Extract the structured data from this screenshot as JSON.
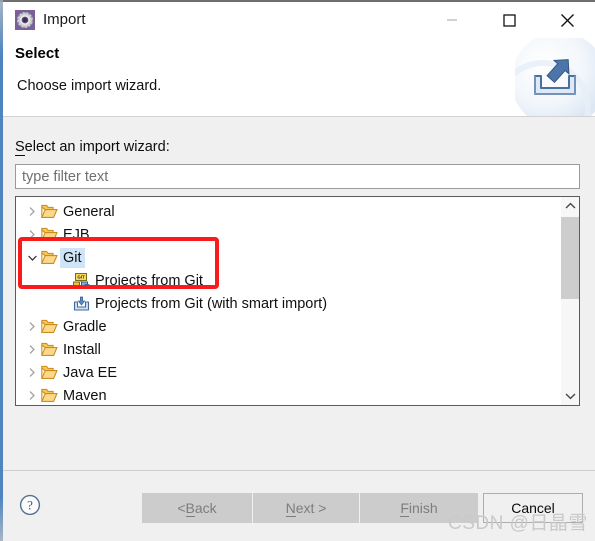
{
  "window": {
    "title": "Import",
    "app_icon": "eclipse-import-gear-icon",
    "controls": {
      "minimize": "minimize-icon",
      "maximize": "maximize-icon",
      "close": "close-icon"
    }
  },
  "header": {
    "title": "Select",
    "subtitle": "Choose import wizard.",
    "banner_icon": "import-tray-arrow-icon"
  },
  "body": {
    "wizard_label_prefix": "S",
    "wizard_label_rest": "elect an import wizard:",
    "filter": {
      "value": "",
      "placeholder": "type filter text"
    },
    "tree": [
      {
        "label": "General",
        "icon": "folder-icon",
        "indent": 0,
        "twisty": "collapsed",
        "selected": false
      },
      {
        "label": "EJB",
        "icon": "folder-icon",
        "indent": 0,
        "twisty": "collapsed",
        "selected": false
      },
      {
        "label": "Git",
        "icon": "folder-icon",
        "indent": 0,
        "twisty": "expanded",
        "selected": true
      },
      {
        "label": "Projects from Git",
        "icon": "git-projects-icon",
        "indent": 1,
        "twisty": "none",
        "selected": false
      },
      {
        "label": "Projects from Git (with smart import)",
        "icon": "git-smart-import-icon",
        "indent": 1,
        "twisty": "none",
        "selected": false
      },
      {
        "label": "Gradle",
        "icon": "folder-icon",
        "indent": 0,
        "twisty": "collapsed",
        "selected": false
      },
      {
        "label": "Install",
        "icon": "folder-icon",
        "indent": 0,
        "twisty": "collapsed",
        "selected": false
      },
      {
        "label": "Java EE",
        "icon": "folder-icon",
        "indent": 0,
        "twisty": "collapsed",
        "selected": false
      },
      {
        "label": "Maven",
        "icon": "folder-icon",
        "indent": 0,
        "twisty": "collapsed",
        "selected": false
      }
    ],
    "annotation": {
      "color": "#f91b1b",
      "targets": [
        "Git",
        "Projects from Git"
      ]
    },
    "scrollbar": {
      "up_icon": "chevron-up-icon",
      "down_icon": "chevron-down-icon",
      "thumb_position_percent": 2
    }
  },
  "footer": {
    "help_icon": "help-question-icon",
    "buttons": [
      {
        "label_prefix": "< ",
        "label_key": "B",
        "label_rest": "ack",
        "full": "< Back",
        "enabled": false
      },
      {
        "label_prefix": "",
        "label_key": "N",
        "label_rest": "ext >",
        "full": "Next >",
        "enabled": false
      },
      {
        "label_prefix": "",
        "label_key": "F",
        "label_rest": "inish",
        "full": "Finish",
        "enabled": false
      },
      {
        "label_prefix": "",
        "label_key": "",
        "label_rest": "Cancel",
        "full": "Cancel",
        "enabled": true
      }
    ]
  },
  "watermark": "CSDN @日晶雪",
  "colors": {
    "selection": "#cfe4f7",
    "annotation": "#f91b1b",
    "dialog_bg": "#f0f0f0",
    "folder": "#f3b33d"
  }
}
